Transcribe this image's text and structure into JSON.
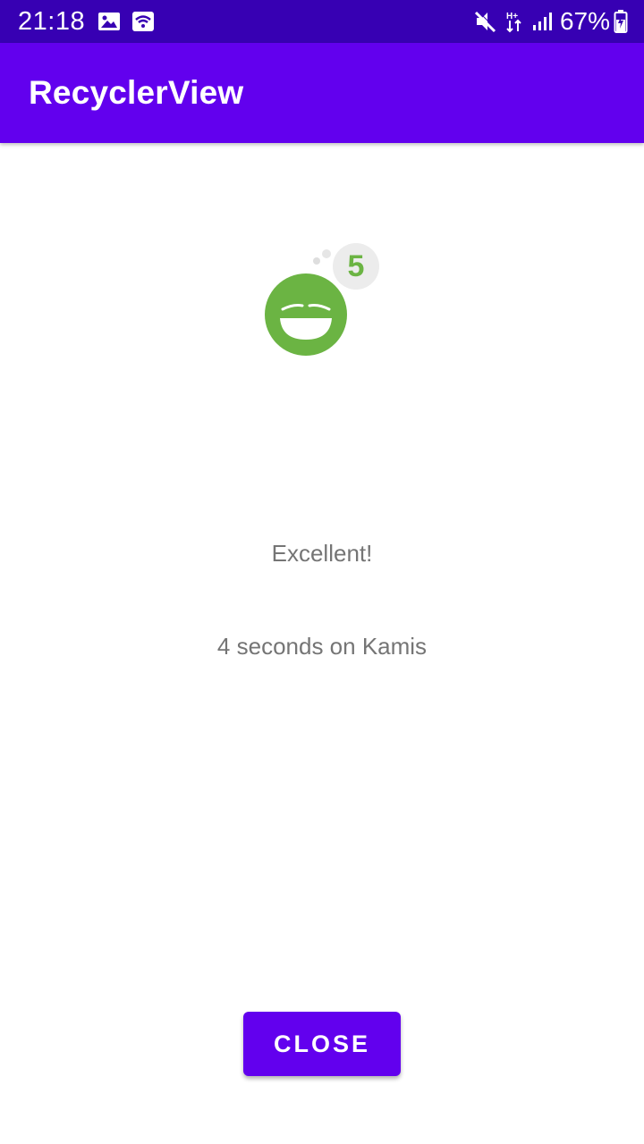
{
  "status_bar": {
    "time": "21:18",
    "battery": "67%",
    "icons": [
      "image-icon",
      "wifi-hotspot-icon",
      "mute-icon",
      "data-arrows-icon",
      "signal-icon",
      "battery-charging-icon"
    ]
  },
  "app_bar": {
    "title": "RecyclerView"
  },
  "rating": {
    "score": "5",
    "icon": "laughing-face-icon",
    "face_color": "#6BB443",
    "label": "Excellent!",
    "detail": "4 seconds on Kamis"
  },
  "actions": {
    "close_label": "CLOSE"
  },
  "colors": {
    "status_bar": "#3700B3",
    "primary": "#6200EE",
    "text_secondary": "#757575"
  }
}
